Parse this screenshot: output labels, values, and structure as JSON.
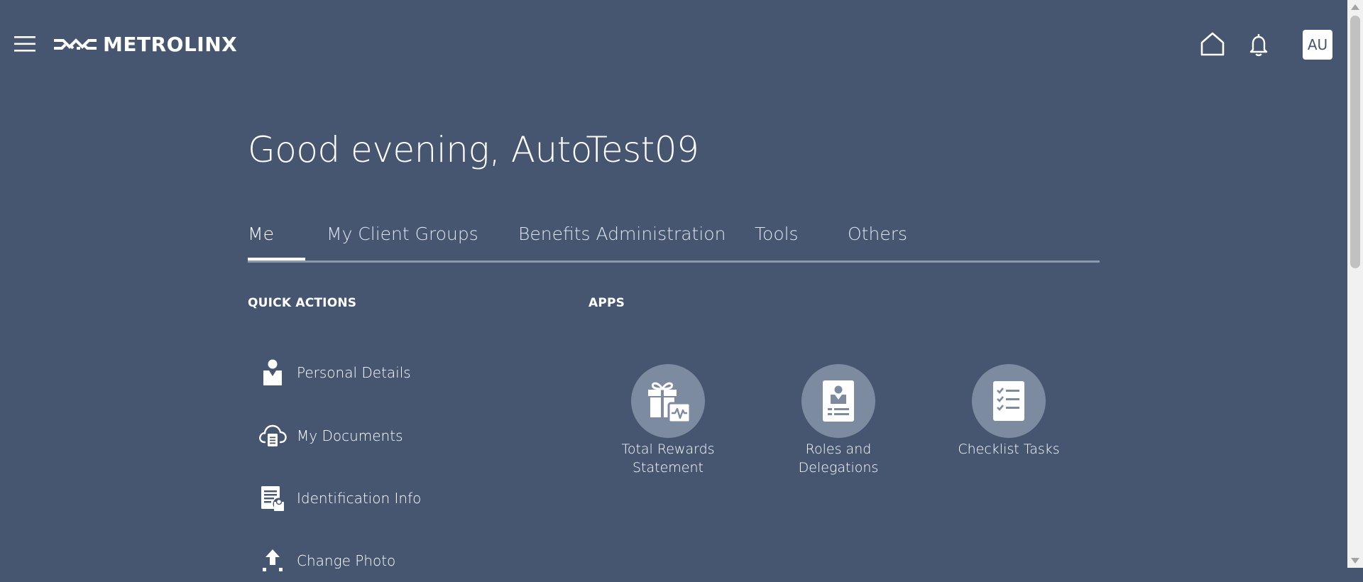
{
  "header": {
    "logo_text": "METROLINX",
    "avatar_initials": "AU",
    "icons": [
      "menu-icon",
      "home-icon",
      "bell-icon"
    ]
  },
  "greeting": "Good evening, AutoTest09",
  "tabs": [
    {
      "label": "Me",
      "active": true
    },
    {
      "label": "My Client Groups",
      "active": false
    },
    {
      "label": "Benefits Administration",
      "active": false
    },
    {
      "label": "Tools",
      "active": false
    },
    {
      "label": "Others",
      "active": false
    }
  ],
  "quick_actions": {
    "title": "QUICK ACTIONS",
    "items": [
      {
        "label": "Personal Details",
        "icon": "person-icon"
      },
      {
        "label": "My Documents",
        "icon": "cloud-document-icon"
      },
      {
        "label": "Identification Info",
        "icon": "id-document-icon"
      },
      {
        "label": "Change Photo",
        "icon": "upload-icon"
      }
    ]
  },
  "apps": {
    "title": "APPS",
    "items": [
      {
        "label": "Total Rewards\nStatement",
        "icon": "gift-chart-icon"
      },
      {
        "label": "Roles and\nDelegations",
        "icon": "badge-icon"
      },
      {
        "label": "Checklist Tasks",
        "icon": "checklist-icon"
      }
    ]
  },
  "colors": {
    "background": "#465671",
    "app_circle": "#7d8ba1",
    "tab_rule": "#8d9aad",
    "text": "#ffffff"
  }
}
